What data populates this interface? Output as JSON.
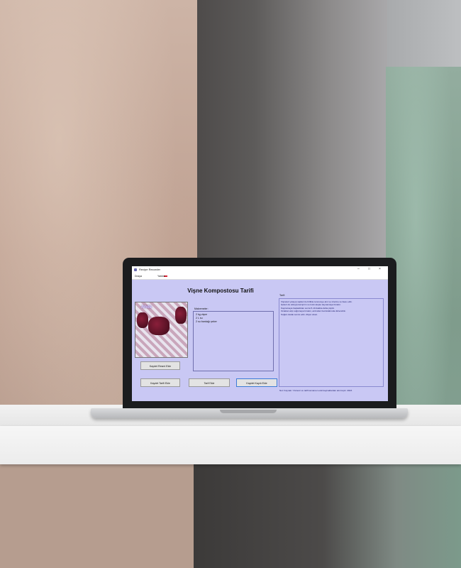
{
  "window": {
    "title": "Recipe Recorder",
    "menu": [
      "Dosya",
      "Yardım"
    ]
  },
  "recipe": {
    "title": "Vişne Kompostosu Tarifi",
    "photo_caption": "Ahde",
    "ingredients_label": "Malzemeler:",
    "ingredients": [
      "2 kg vişne",
      "2 L su",
      "2 su bardağı şeker"
    ],
    "instructions_label": "Tarif:",
    "instructions": [
      "Vişneleri yıkayıp sapları ile birlikte tencereye alın ve üzerine su ilave edin.",
      "Şekeri de ekleyip karıştırın ve kısık ateşte kaynamaya bırakın.",
      "Kaynamaya başladıktan sonra 5-10 dakika daha pişirin.",
      "Ocaktan alıp soğumaya bırakın, ardından buzdolabında dinlendirin.",
      "Soğuk olarak servis edin. Afiyet olsun."
    ],
    "note": "Not: Kaynak: Yöntemi ve tarifi tamamen eski kaynaklardan alınmıştır. 2023."
  },
  "buttons": {
    "photo": "Kaydet Resmi Ekle",
    "recipe": "Kaydet Tarifi Ekle",
    "add": "Tarif Ekle",
    "save": "Kaydet Kaydı Ekle"
  },
  "colors": {
    "window_bg": "#c9c8f4",
    "instruction_text": "#1a1a6a"
  }
}
